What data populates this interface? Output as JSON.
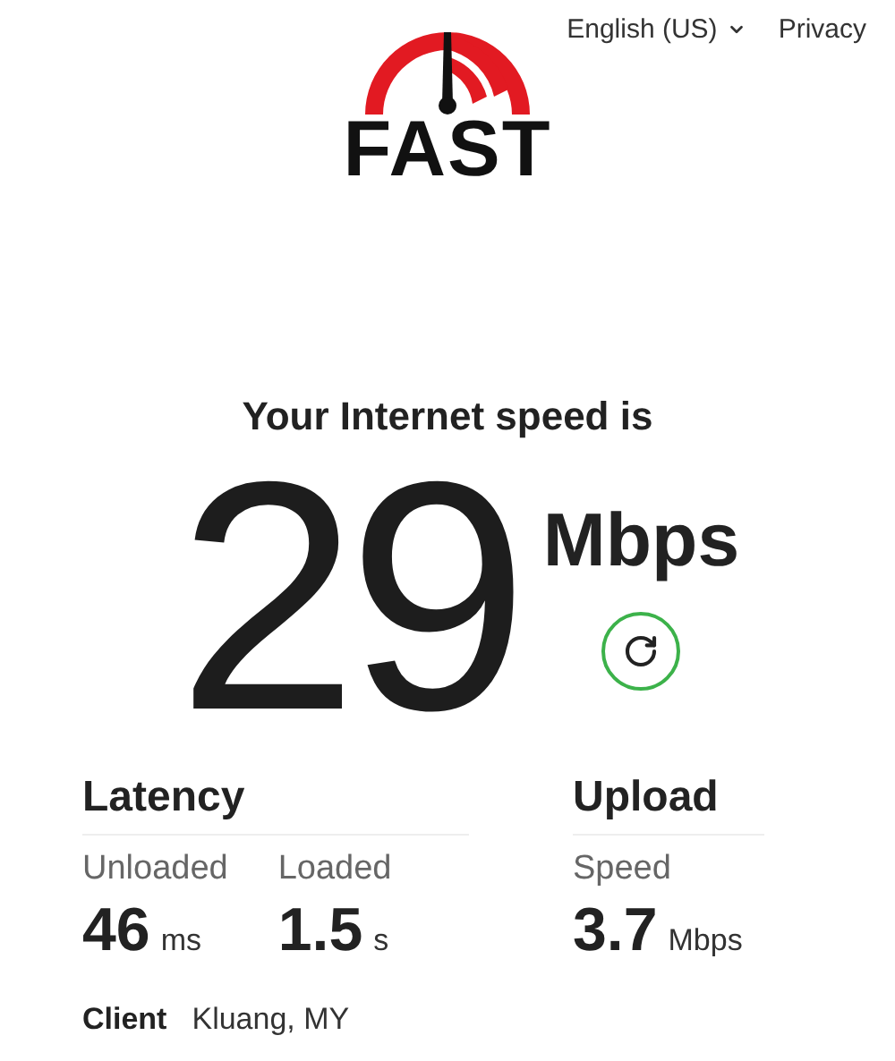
{
  "header": {
    "logo_text": "FAST",
    "language": "English (US)",
    "privacy": "Privacy"
  },
  "speed": {
    "caption": "Your Internet speed is",
    "value": "29",
    "unit": "Mbps"
  },
  "sections": [
    {
      "title": "Latency",
      "metrics": [
        {
          "label": "Unloaded",
          "value": "46",
          "unit": "ms"
        },
        {
          "label": "Loaded",
          "value": "1.5",
          "unit": "s"
        }
      ]
    },
    {
      "title": "Upload",
      "metrics": [
        {
          "label": "Speed",
          "value": "3.7",
          "unit": "Mbps"
        }
      ]
    }
  ],
  "client": {
    "label": "Client",
    "value": "Kluang, MY"
  }
}
